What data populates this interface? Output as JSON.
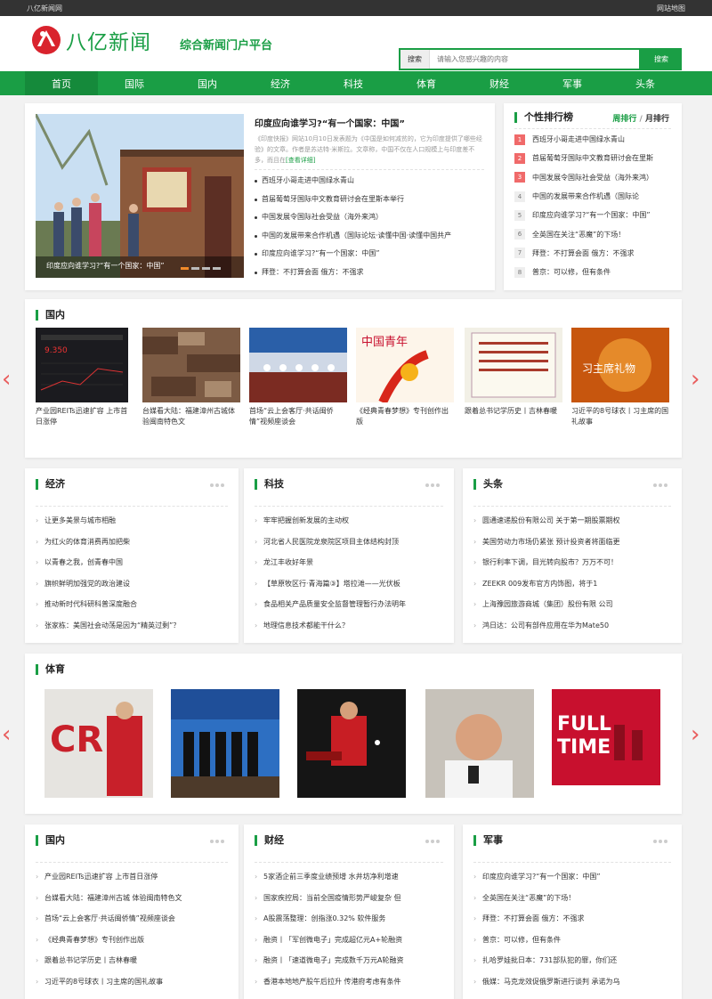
{
  "topbar": {
    "left": "八亿新闻网",
    "right": "网站地图"
  },
  "header": {
    "logo_text": "八亿新闻",
    "slogan": "综合新闻门户平台",
    "search_label": "搜索",
    "search_placeholder": "请输入您感兴趣的内容",
    "search_button": "搜索"
  },
  "nav": [
    "首页",
    "国际",
    "国内",
    "经济",
    "科技",
    "体育",
    "财经",
    "军事",
    "头条"
  ],
  "featured": {
    "slide_caption": "印度应向谁学习?“有一个国家：中国”",
    "headline": "印度应向谁学习?“有一个国家：中国”",
    "summary": "《印度快报》网站10月10日发表题为《中国是如何减贫的，它为印度提供了哪些经验》的文章。作者是苏达特·米斯拉。文章称，中国不仅在人口规模上与印度差不多，而且在",
    "more": "[查看详细]",
    "items": [
      "西班牙小哥走进中国绿水青山",
      "首届葡萄牙国际中文教育研讨会在里斯本举行",
      "中国发展令国际社会受益（海外来鸿）",
      "中国的发展带来合作机遇（国际论坛·读懂中国·读懂中国共产",
      "印度应向谁学习?“有一个国家：中国”",
      "拜登：不打算会面 俄方：不强求"
    ]
  },
  "ranking": {
    "title": "个性排行榜",
    "tab_week": "周排行",
    "separator": "/",
    "tab_month": "月排行",
    "items": [
      {
        "num": "1",
        "text": "西班牙小哥走进中国绿水青山"
      },
      {
        "num": "2",
        "text": "首届葡萄牙国际中文教育研讨会在里斯"
      },
      {
        "num": "3",
        "text": "中国发展令国际社会受益（海外来鸿）"
      },
      {
        "num": "4",
        "text": "中国的发展带来合作机遇（国际论"
      },
      {
        "num": "5",
        "text": "印度应向谁学习?“有一个国家：中国”"
      },
      {
        "num": "6",
        "text": "全英国在关注“恶魔”的下场！"
      },
      {
        "num": "7",
        "text": "拜登：不打算会面 俄方：不强求"
      },
      {
        "num": "8",
        "text": "普京：可以修，但有条件"
      }
    ]
  },
  "domestic_gallery": {
    "title": "国内",
    "items": [
      "产业园REITs迅速扩容 上市首日涨停",
      "台媒看大陆：福建漳州古城体验闽南特色文",
      "首场“云上会客厅·共话闽侨情”视频座谈会",
      "《经典青春梦想》专刊创作出版",
      "跟着总书记学历史丨吉林春暖",
      "习近平的8号球衣丨习主席的国礼故事"
    ]
  },
  "economy": {
    "title": "经济",
    "items": [
      "让更多美景与城市相融",
      "为红火的体育消费再加把柴",
      "以青春之我，创青春中国",
      "旗帜鲜明加强党的政治建设",
      "推动新时代科研科普深度融合",
      "张家栋：美国社会动荡是因为“精英过剩”？"
    ]
  },
  "tech": {
    "title": "科技",
    "items": [
      "牢牢把握创新发展的主动权",
      "河北省人民医院龙泉院区项目主体结构封顶",
      "龙江丰收好年景",
      "【草原牧区行·青海篇③】塔拉滩——光伏板",
      "食品相关产品质量安全监督管理暂行办法明年",
      "地理信息技术都能干什么？"
    ]
  },
  "headline": {
    "title": "头条",
    "items": [
      "圆通速递股份有限公司 关于第一期股票期权",
      "美国劳动力市场仍紧张 预计投资者将面临更",
      "银行利率下调，目光转向股市？万万不可！",
      "ZEEKR 009发布官方内饰图，将于1",
      "上海豫园旅游商城（集团）股份有限 公司",
      "鸿日达：公司有部件应用在华为Mate50"
    ]
  },
  "sports": {
    "title": "体育"
  },
  "domestic2": {
    "title": "国内",
    "items": [
      "产业园REITs迅速扩容 上市首日涨停",
      "台媒看大陆：福建漳州古城 体验闽南特色文",
      "首场“云上会客厅·共话闽侨情”视频座谈会",
      "《经典青春梦想》专刊创作出版",
      "跟着总书记学历史丨吉林春暖",
      "习近平的8号球衣丨习主席的国礼故事"
    ]
  },
  "finance": {
    "title": "财经",
    "items": [
      "5家酒企前三季度业绩预增 水井坊净利增速",
      "国家疾控局：当前全国疫情形势严峻复杂 但",
      "A股震荡整理：创指涨0.32% 软件服务",
      "融资丨「军创微电子」完成超亿元A+轮融资",
      "融资丨「速道微电子」完成数千万元A轮融资",
      "香港本地地产股午后拉升 传港府考虑有条件"
    ]
  },
  "military": {
    "title": "军事",
    "items": [
      "印度应向谁学习?“有一个国家：中国”",
      "全英国在关注“恶魔”的下场！",
      "拜登：不打算会面 俄方：不强求",
      "普京：可以修，但有条件",
      "扎哈罗娃批日本：731部队犯的罪，你们还",
      "俄媒：马克龙效促俄罗斯进行谈判 承诺为乌"
    ]
  },
  "colors": {
    "brand_green": "#1a9e45",
    "hot_red": "#f06a6a",
    "arrow_red": "#e95d5d"
  }
}
